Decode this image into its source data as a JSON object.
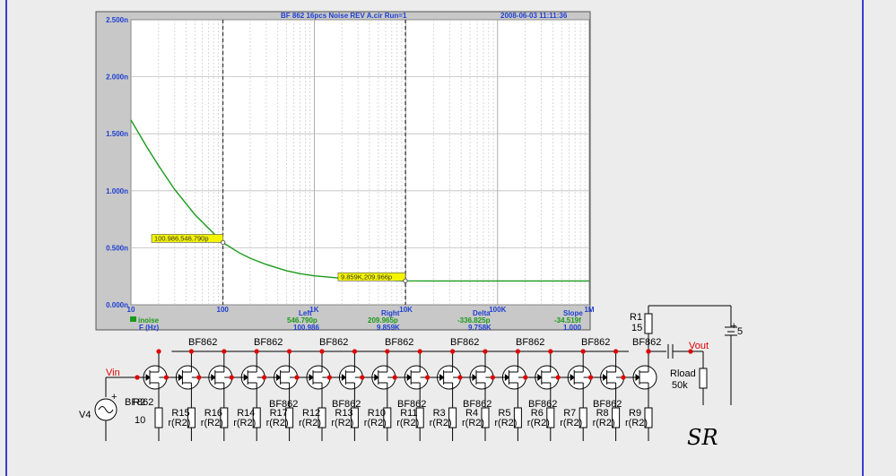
{
  "chart_data": {
    "type": "line",
    "title": "BF 862 16pcs Noise REV A.cir Run=1",
    "timestamp": "2008-06-03 11:11:36",
    "x_scale": "log",
    "xlim": [
      10,
      1000000
    ],
    "x_ticks": [
      "10",
      "100",
      "1K",
      "10K",
      "100K",
      "1M"
    ],
    "ylim": [
      0,
      2.5
    ],
    "y_unit": "n",
    "y_ticks": [
      "0.000n",
      "0.500n",
      "1.000n",
      "1.500n",
      "2.000n",
      "2.500n"
    ],
    "xlabel": "F (Hz)",
    "legend": "inoise",
    "grid": true,
    "series": [
      {
        "name": "inoise",
        "color": "#1a9a1a",
        "x": [
          10,
          15,
          20,
          30,
          50,
          70,
          100,
          150,
          200,
          300,
          500,
          700,
          1000,
          2000,
          5000,
          9859,
          20000,
          100000,
          1000000
        ],
        "y": [
          1.62,
          1.38,
          1.22,
          1.01,
          0.79,
          0.672,
          0.547,
          0.458,
          0.408,
          0.353,
          0.298,
          0.273,
          0.254,
          0.233,
          0.218,
          0.21,
          0.209,
          0.209,
          0.209
        ]
      }
    ],
    "cursors": {
      "left": {
        "x": 100.986,
        "y": "546.790p",
        "label": "100.986,546.790p"
      },
      "right": {
        "x": 9859,
        "y": "209.966p",
        "label": "9.859K,209.966p"
      }
    },
    "readout": {
      "headers": [
        "Left",
        "Right",
        "Delta",
        "Slope"
      ],
      "values_row1": [
        "546.790p",
        "209.965p",
        "-336.825p",
        "-34.519f"
      ],
      "values_row2": [
        "100.986",
        "9.859K",
        "9.758K",
        "1.000"
      ]
    }
  },
  "schematic": {
    "jfet_label": "BF862",
    "input_label": "Vin",
    "output_label": "Vout",
    "source_label": "V4",
    "r1": {
      "name": "R1",
      "value": "15"
    },
    "r2": {
      "name": "R2",
      "value": "10"
    },
    "rload": {
      "name": "Rload",
      "value": "50k"
    },
    "battery_value": "5",
    "resistor_names": [
      "R15",
      "R16",
      "R14",
      "R17",
      "R12",
      "R13",
      "R10",
      "R11",
      "R3",
      "R4",
      "R5",
      "R6",
      "R7",
      "R8",
      "R9"
    ],
    "resistor_value": "r(R2)",
    "signature": "SR"
  }
}
